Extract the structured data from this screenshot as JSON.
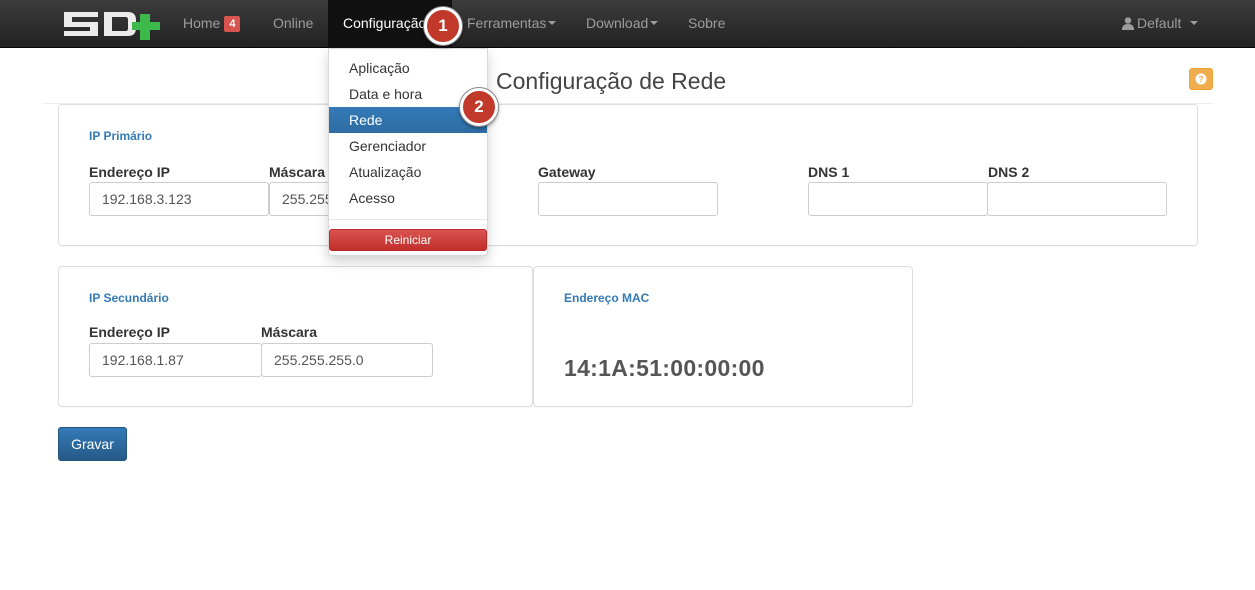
{
  "navbar": {
    "brand": "SD+",
    "items": [
      {
        "label": "Home",
        "badge": "4"
      },
      {
        "label": "Online"
      },
      {
        "label": "Configuração"
      },
      {
        "label": "Ferramentas"
      },
      {
        "label": "Download"
      },
      {
        "label": "Sobre"
      }
    ],
    "user": "Default"
  },
  "dropdown": {
    "items": [
      "Aplicação",
      "Data e hora",
      "Rede",
      "Gerenciador",
      "Atualização",
      "Acesso"
    ],
    "active": "Rede",
    "restart_label": "Reiniciar"
  },
  "page": {
    "title": "Configuração de Rede",
    "help_icon": "question-icon"
  },
  "primary": {
    "heading": "IP Primário",
    "ip_label": "Endereço IP",
    "ip_value": "192.168.3.123",
    "mask_label": "Máscara",
    "mask_value": "255.255",
    "gateway_label": "Gateway",
    "gateway_value": "",
    "dns1_label": "DNS 1",
    "dns1_value": "",
    "dns2_label": "DNS 2",
    "dns2_value": ""
  },
  "secondary": {
    "heading": "IP Secundário",
    "ip_label": "Endereço IP",
    "ip_value": "192.168.1.87",
    "mask_label": "Máscara",
    "mask_value": "255.255.255.0"
  },
  "mac": {
    "heading": "Endereço MAC",
    "value": "14:1A:51:00:00:00"
  },
  "actions": {
    "save_label": "Gravar"
  },
  "markers": [
    "1",
    "2"
  ],
  "colors": {
    "navbar": "#222222",
    "primary": "#337ab7",
    "danger": "#d9534f",
    "warning": "#f0ad4e",
    "marker": "#c0392b",
    "brand_green": "#3cb94a"
  }
}
